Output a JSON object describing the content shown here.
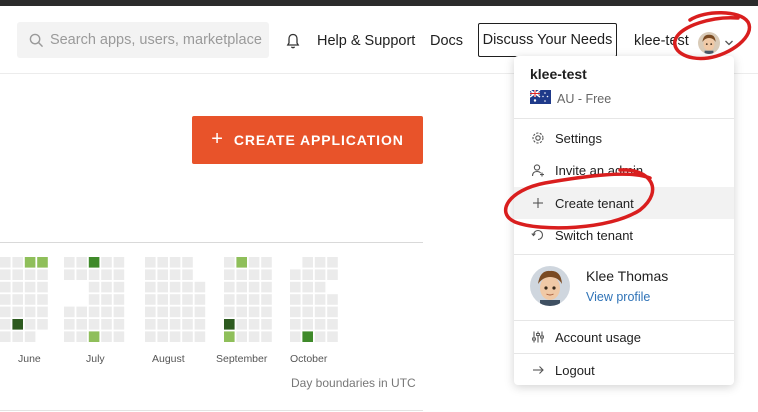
{
  "header": {
    "search_placeholder": "Search apps, users, marketplace",
    "help_label": "Help & Support",
    "docs_label": "Docs",
    "discuss_label": "Discuss Your Needs",
    "tenant_name": "klee-test"
  },
  "main": {
    "create_app_label": "CREATE APPLICATION",
    "months": [
      "June",
      "July",
      "August",
      "September",
      "October"
    ],
    "day_boundaries_note": "Day boundaries in UTC"
  },
  "dropdown": {
    "tenant_name": "klee-test",
    "region": "AU - Free",
    "items": {
      "settings": "Settings",
      "invite": "Invite an admin",
      "create_tenant": "Create tenant",
      "switch_tenant": "Switch tenant",
      "account_usage": "Account usage",
      "logout": "Logout"
    },
    "user": {
      "name": "Klee Thomas",
      "view_profile": "View profile"
    }
  },
  "colors": {
    "accent": "#e8532a",
    "link": "#2f73b7",
    "annotation": "#d91e1e",
    "heat_empty": "#ebebeb",
    "heat_light": "#8fbf5a",
    "heat_mid": "#3f8a2a",
    "heat_dark": "#2d5a1f"
  },
  "icons": [
    "search-icon",
    "bell-icon",
    "chevron-down-icon",
    "gear-icon",
    "user-add-icon",
    "plus-icon",
    "switch-icon",
    "sliders-icon",
    "arrow-right-icon"
  ]
}
